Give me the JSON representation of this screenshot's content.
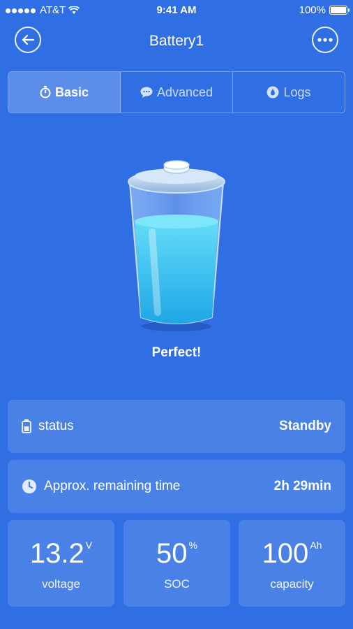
{
  "statusbar": {
    "carrier": "AT&T",
    "time": "9:41 AM",
    "battery": "100%"
  },
  "header": {
    "title": "Battery1"
  },
  "tabs": [
    {
      "label": "Basic",
      "active": true
    },
    {
      "label": "Advanced",
      "active": false
    },
    {
      "label": "Logs",
      "active": false
    }
  ],
  "status_message": "Perfect!",
  "rows": {
    "status": {
      "label": "status",
      "value": "Standby"
    },
    "remaining": {
      "label": "Approx. remaining time",
      "value": "2h 29min"
    }
  },
  "cards": [
    {
      "value": "13.2",
      "unit": "V",
      "caption": "voltage"
    },
    {
      "value": "50",
      "unit": "%",
      "caption": "SOC"
    },
    {
      "value": "100",
      "unit": "Ah",
      "caption": "capacity"
    }
  ],
  "colors": {
    "background": "#2f6fe3",
    "liquid": "#3ec8f0"
  }
}
